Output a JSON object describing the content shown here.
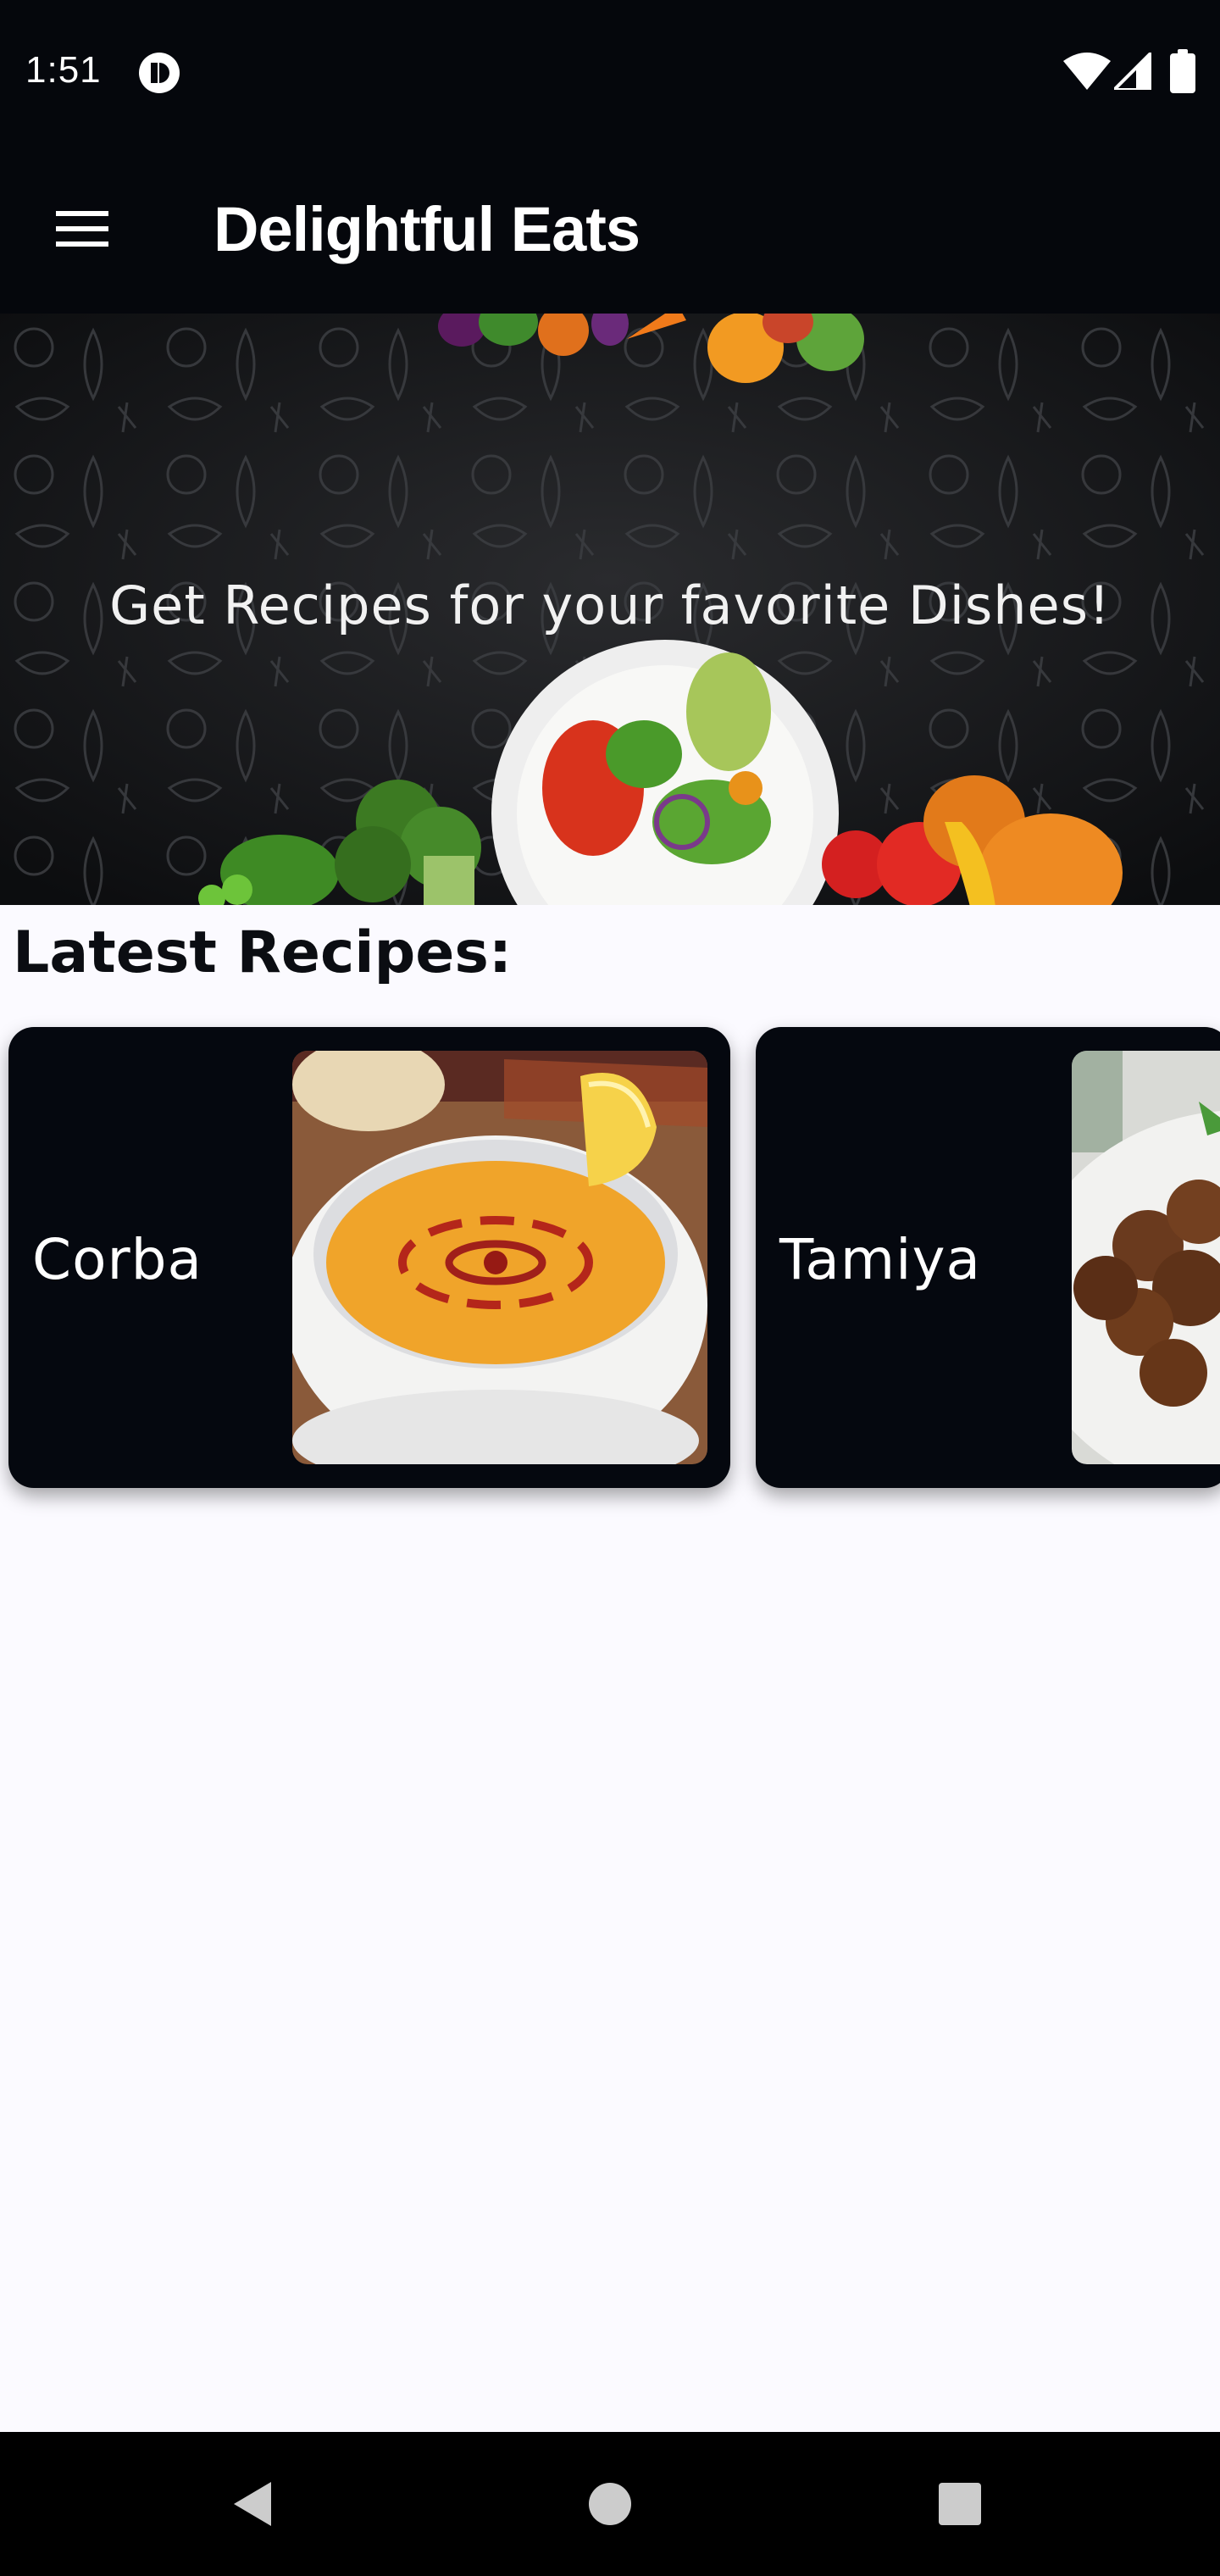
{
  "status_bar": {
    "time": "1:51",
    "icons": [
      "app-notification-icon",
      "wifi-icon",
      "cell-signal-icon",
      "battery-icon"
    ]
  },
  "app_bar": {
    "menu_icon": "hamburger-menu-icon",
    "title": "Delightful Eats"
  },
  "hero": {
    "tagline": "Get Recipes for your favorite Dishes!"
  },
  "latest": {
    "heading": "Latest Recipes:",
    "recipes": [
      {
        "name": "Corba",
        "image": "lentil-soup-image"
      },
      {
        "name": "Tamiya",
        "image": "falafel-image"
      }
    ]
  },
  "nav_bar": {
    "icons": [
      "back-icon",
      "home-icon",
      "recents-icon"
    ]
  },
  "colors": {
    "bars": "#05070c",
    "page_background": "#fbfaff",
    "card_background": "#05080f",
    "text_light": "#ffffff"
  }
}
